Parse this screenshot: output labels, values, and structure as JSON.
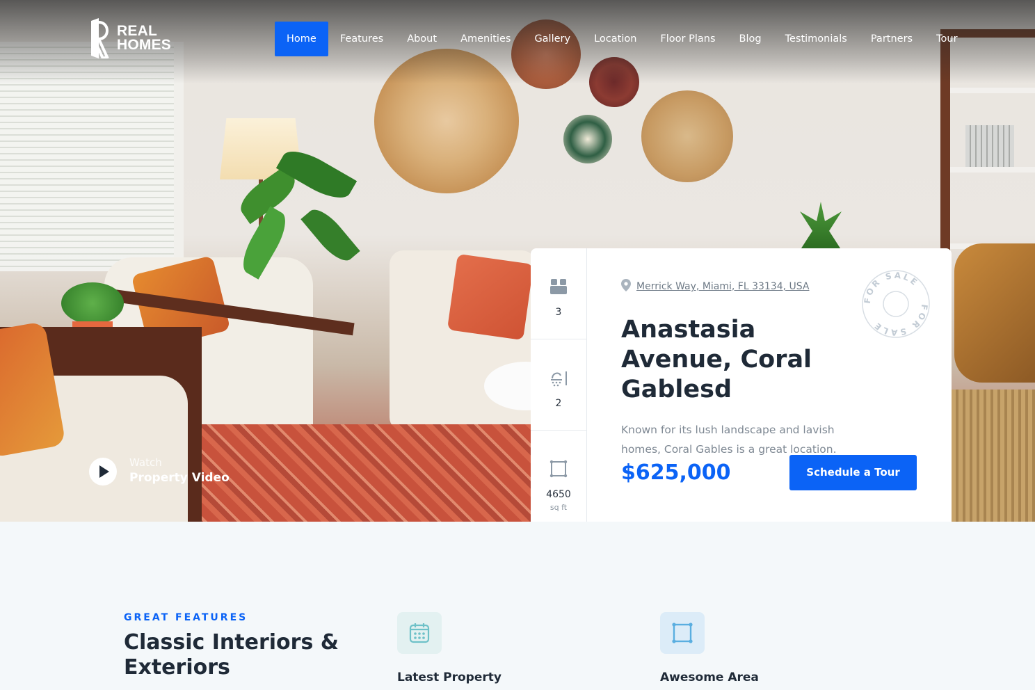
{
  "brand": {
    "line1": "REAL",
    "line2": "HOMES"
  },
  "nav": {
    "items": [
      {
        "label": "Home",
        "active": true
      },
      {
        "label": "Features"
      },
      {
        "label": "About"
      },
      {
        "label": "Amenities"
      },
      {
        "label": "Gallery"
      },
      {
        "label": "Location"
      },
      {
        "label": "Floor Plans"
      },
      {
        "label": "Blog"
      },
      {
        "label": "Testimonials"
      },
      {
        "label": "Partners"
      },
      {
        "label": "Tour"
      }
    ]
  },
  "video": {
    "small": "Watch",
    "big": "Property Video"
  },
  "property": {
    "address": "Merrick Way, Miami, FL 33134, USA",
    "title": "Anastasia Avenue, Coral Gablesd",
    "description": "Known for its lush landscape and lavish homes, Coral Gables is a great location.",
    "price": "$625,000",
    "cta": "Schedule a Tour",
    "badge": "FOR SALE",
    "specs": {
      "bedrooms": "3",
      "bathrooms": "2",
      "area": "4650",
      "area_unit": "sq ft"
    }
  },
  "features": {
    "eyebrow": "GREAT FEATURES",
    "title": "Classic Interiors & Exteriors",
    "items": [
      {
        "label": "Latest Property",
        "icon": "calendar-icon",
        "bg": "#e3f1f1"
      },
      {
        "label": "Awesome Area",
        "icon": "area-icon",
        "bg": "#dcecf8"
      }
    ]
  },
  "colors": {
    "accent": "#0b63f6",
    "text": "#1f2a37",
    "muted": "#7e8893"
  }
}
